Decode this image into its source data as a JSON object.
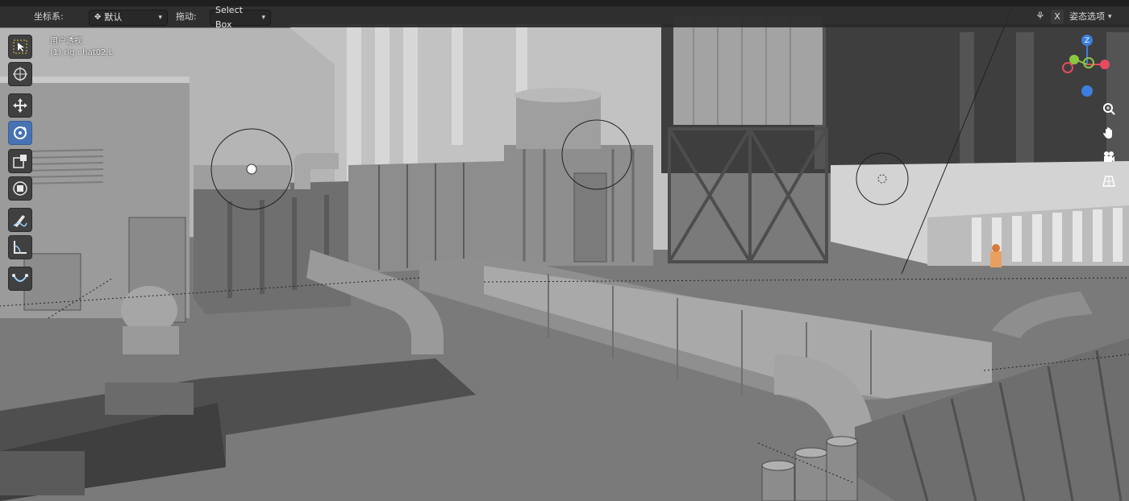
{
  "header": {
    "coord_label": "坐标系:",
    "coord_value": "默认",
    "drag_label": "拖动:",
    "drag_value": "Select Box",
    "x_button": "X",
    "pose_options": "姿态选项"
  },
  "viewport": {
    "view_name": "用户透视",
    "active_object": "(1) rig : hat02.L"
  },
  "gizmo": {
    "z_label": "Z",
    "colors": {
      "x": "#e84a5f",
      "y": "#8cc63f",
      "z": "#3d7fe0"
    }
  },
  "toolbar": {
    "tools": [
      "select-box",
      "cursor",
      "move",
      "rotate",
      "scale",
      "transform",
      "annotate",
      "measure",
      "curve"
    ],
    "active": "rotate",
    "accent": "#4772b3"
  },
  "navigation": [
    "zoom-icon",
    "hand-icon",
    "camera-icon",
    "grid-icon"
  ]
}
